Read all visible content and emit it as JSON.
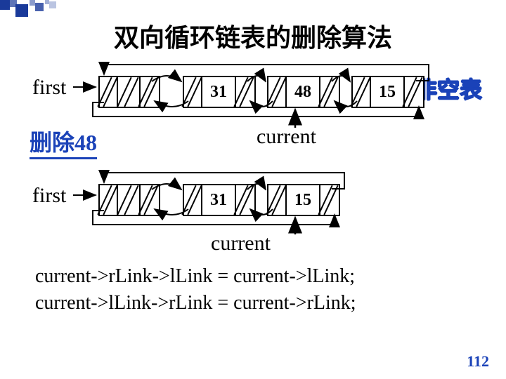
{
  "title": "双向循环链表的删除算法",
  "labels": {
    "first": "first",
    "delete48": "删除48",
    "nonEmpty": "非空表",
    "current": "current"
  },
  "list1": {
    "nodes": [
      {
        "data": null
      },
      {
        "data": "31"
      },
      {
        "data": "48"
      },
      {
        "data": "15"
      }
    ],
    "currentIndex": 2
  },
  "list2": {
    "nodes": [
      {
        "data": null
      },
      {
        "data": "31"
      },
      {
        "data": "15"
      }
    ],
    "currentIndex": 2
  },
  "code": {
    "line1": "current->rLink->lLink = current->lLink;",
    "line2": "current->lLink->rLink = current->rLink;"
  },
  "pageNumber": "112"
}
